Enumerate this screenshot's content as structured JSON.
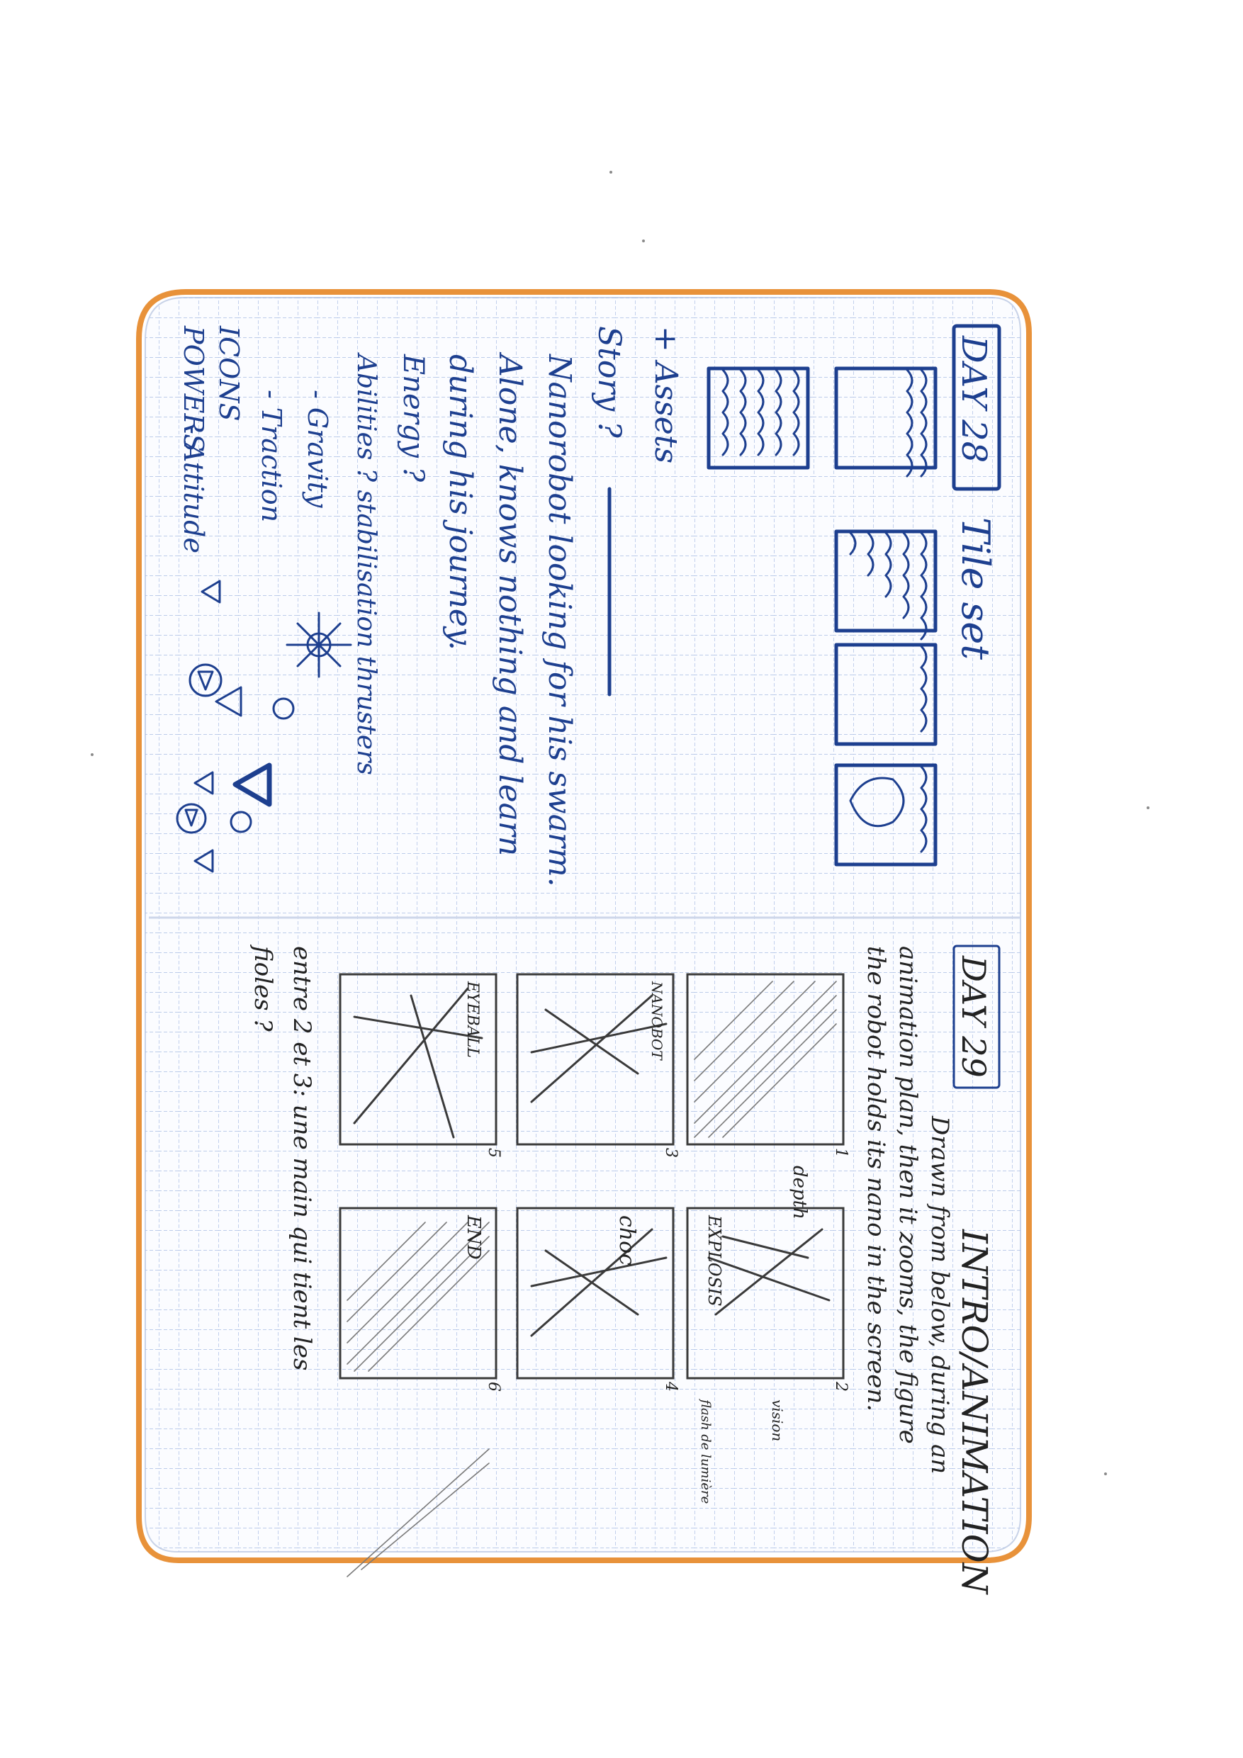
{
  "notebook": {
    "colors": {
      "paper": "#fbfcff",
      "grid": "#9fb3de",
      "edge": "#e8923a",
      "blue_ink": "#1d3f8f",
      "pencil": "#333333"
    }
  },
  "day28": {
    "badge": "DAY 28",
    "title": "Tile set",
    "assets_label": "+ Assets",
    "story_label": "Story ?",
    "story_lines": [
      "Nanorobot looking for his swarm.",
      "Alone, knows nothing and learn",
      "during his journey."
    ],
    "energy": "Energy ?",
    "abilities": "Abilities ? stabilisation thrusters",
    "ability_list": [
      "- Gravity",
      "- Traction"
    ],
    "icons": "ICONS",
    "powers": "POWERS",
    "attitude": "- Attitude"
  },
  "day29": {
    "badge": "DAY 29",
    "title": "INTRO/ANIMATION",
    "notes": [
      "Drawn from below, during an",
      "animation plan, then it zooms, the figure",
      "the robot holds its nano in the screen."
    ],
    "panel_labels": [
      "1",
      "2",
      "3",
      "4",
      "5",
      "6"
    ],
    "panel_texts": [
      "depth",
      "EXPLOSIS",
      "NANOBOT",
      "choc",
      "EYEBALL",
      "END"
    ],
    "side_notes": [
      "vision",
      "flash de lumière"
    ],
    "footer_lines": [
      "entre 2 et 3: une main qui tient les",
      "fioles ?"
    ]
  }
}
